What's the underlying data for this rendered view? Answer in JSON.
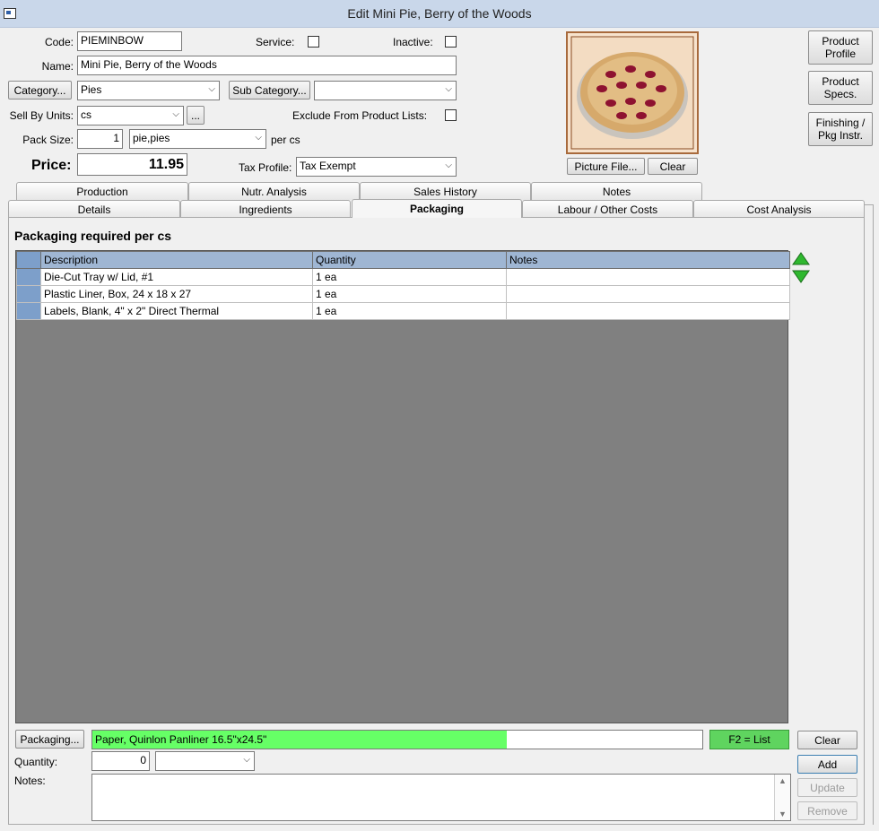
{
  "window": {
    "title": "Edit Mini Pie, Berry of the Woods"
  },
  "form": {
    "code_label": "Code:",
    "code_value": "PIEMINBOW",
    "service_label": "Service:",
    "inactive_label": "Inactive:",
    "name_label": "Name:",
    "name_value": "Mini Pie, Berry of the Woods",
    "category_button": "Category...",
    "category_value": "Pies",
    "subcategory_button": "Sub Category...",
    "subcategory_value": "",
    "sell_by_units_label": "Sell By Units:",
    "sell_by_units_value": "cs",
    "ellipsis_button": "...",
    "exclude_label": "Exclude From Product Lists:",
    "pack_size_label": "Pack Size:",
    "pack_size_value": "1",
    "pack_unit_value": "pie,pies",
    "per_cs_label": "per cs",
    "price_label": "Price:",
    "price_value": "11.95",
    "tax_profile_label": "Tax Profile:",
    "tax_profile_value": "Tax Exempt"
  },
  "picture": {
    "picture_file_button": "Picture File...",
    "clear_button": "Clear"
  },
  "side_buttons": {
    "product_profile": [
      "Product",
      "Profile"
    ],
    "product_specs": [
      "Product",
      "Specs."
    ],
    "finishing": [
      "Finishing /",
      "Pkg Instr."
    ]
  },
  "tabs_row1": [
    "Production",
    "Nutr. Analysis",
    "Sales History",
    "Notes"
  ],
  "tabs_row2": [
    "Details",
    "Ingredients",
    "Packaging",
    "Labour / Other Costs",
    "Cost Analysis"
  ],
  "packaging": {
    "heading": "Packaging required per cs",
    "columns": [
      "Description",
      "Quantity",
      "Notes"
    ],
    "rows": [
      {
        "description": "Die-Cut Tray w/ Lid, #1",
        "quantity": "1 ea",
        "notes": ""
      },
      {
        "description": "Plastic Liner, Box, 24 x 18 x 27",
        "quantity": "1 ea",
        "notes": ""
      },
      {
        "description": "Labels, Blank, 4\" x 2\" Direct Thermal",
        "quantity": "1 ea",
        "notes": ""
      }
    ],
    "packaging_button": "Packaging...",
    "packaging_input": "Paper, Quinlon Panliner 16.5\"x24.5\"",
    "f2_hint": "F2 = List",
    "quantity_label": "Quantity:",
    "quantity_value": "0",
    "unit_value": "",
    "notes_label": "Notes:",
    "notes_value": "",
    "clear_button": "Clear",
    "add_button": "Add",
    "update_button": "Update",
    "remove_button": "Remove"
  },
  "colors": {
    "titlebar": "#c9d7ea",
    "grid_header": "#9fb6d3",
    "grid_bg": "#808080",
    "highlight_green": "#66ff66",
    "f2_green": "#5fd45f"
  },
  "icons": [
    "app-icon",
    "move-up-icon",
    "move-down-icon",
    "dropdown-arrow-icon",
    "scroll-up-icon",
    "scroll-down-icon"
  ]
}
